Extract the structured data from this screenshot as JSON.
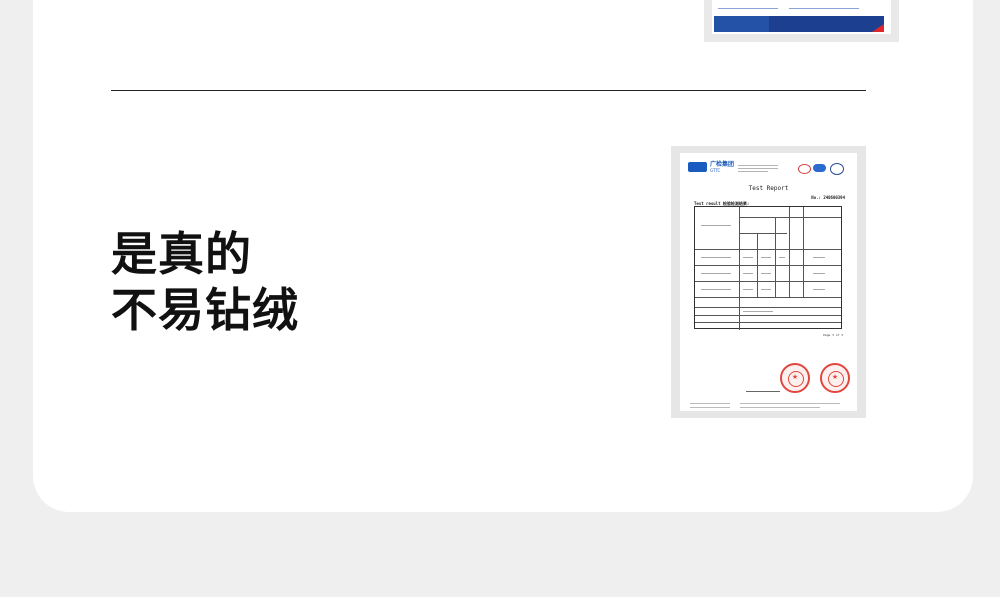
{
  "headline": {
    "line1": "是真的",
    "line2": "不易钻绒"
  },
  "report": {
    "company": "广检集团",
    "company_en": "GTTC",
    "title": "Test Report",
    "report_no": "No.: 240600394",
    "section": "Test result 检验检测结果:",
    "page": "Page 3 of 3"
  },
  "colors": {
    "brand_blue": "#1a5bbf",
    "stamp_red": "#e2473f",
    "text_dark": "#111111",
    "divider": "#222222",
    "page_bg": "#efefef",
    "card_bg": "#ffffff"
  }
}
